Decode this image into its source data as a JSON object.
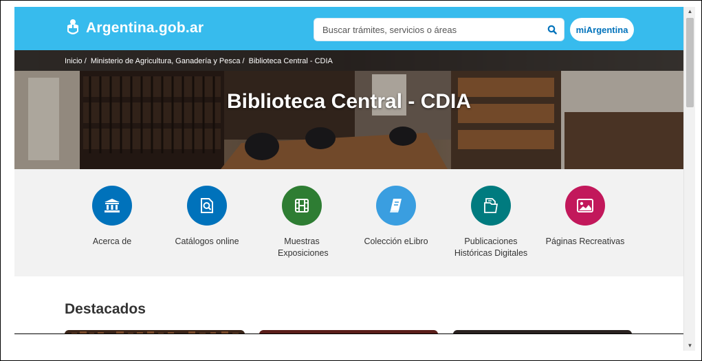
{
  "header": {
    "site_name": "Argentina.gob.ar",
    "search_placeholder": "Buscar trámites, servicios o áreas",
    "account_button": "miArgentina"
  },
  "breadcrumb": {
    "items": [
      "Inicio",
      "Ministerio de Agricultura, Ganadería y Pesca",
      "Biblioteca Central - CDIA"
    ],
    "separator": "/"
  },
  "hero": {
    "title": "Biblioteca Central - CDIA"
  },
  "shortcuts": [
    {
      "label": "Acerca de",
      "icon": "institution-icon",
      "color": "#0072bb"
    },
    {
      "label": "Catálogos online",
      "icon": "catalog-search-icon",
      "color": "#0072bb"
    },
    {
      "label": "Muestras Exposiciones",
      "icon": "film-icon",
      "color": "#2e7d33"
    },
    {
      "label": "Colección eLibro",
      "icon": "book-icon",
      "color": "#3a9ee0"
    },
    {
      "label": "Publicaciones Históricas Digitales",
      "icon": "documents-icon",
      "color": "#007b7f"
    },
    {
      "label": "Páginas Recreativas",
      "icon": "image-icon",
      "color": "#c2185b"
    }
  ],
  "featured": {
    "title": "Destacados"
  },
  "colors": {
    "header": "#37bbed",
    "link": "#0072bb"
  }
}
